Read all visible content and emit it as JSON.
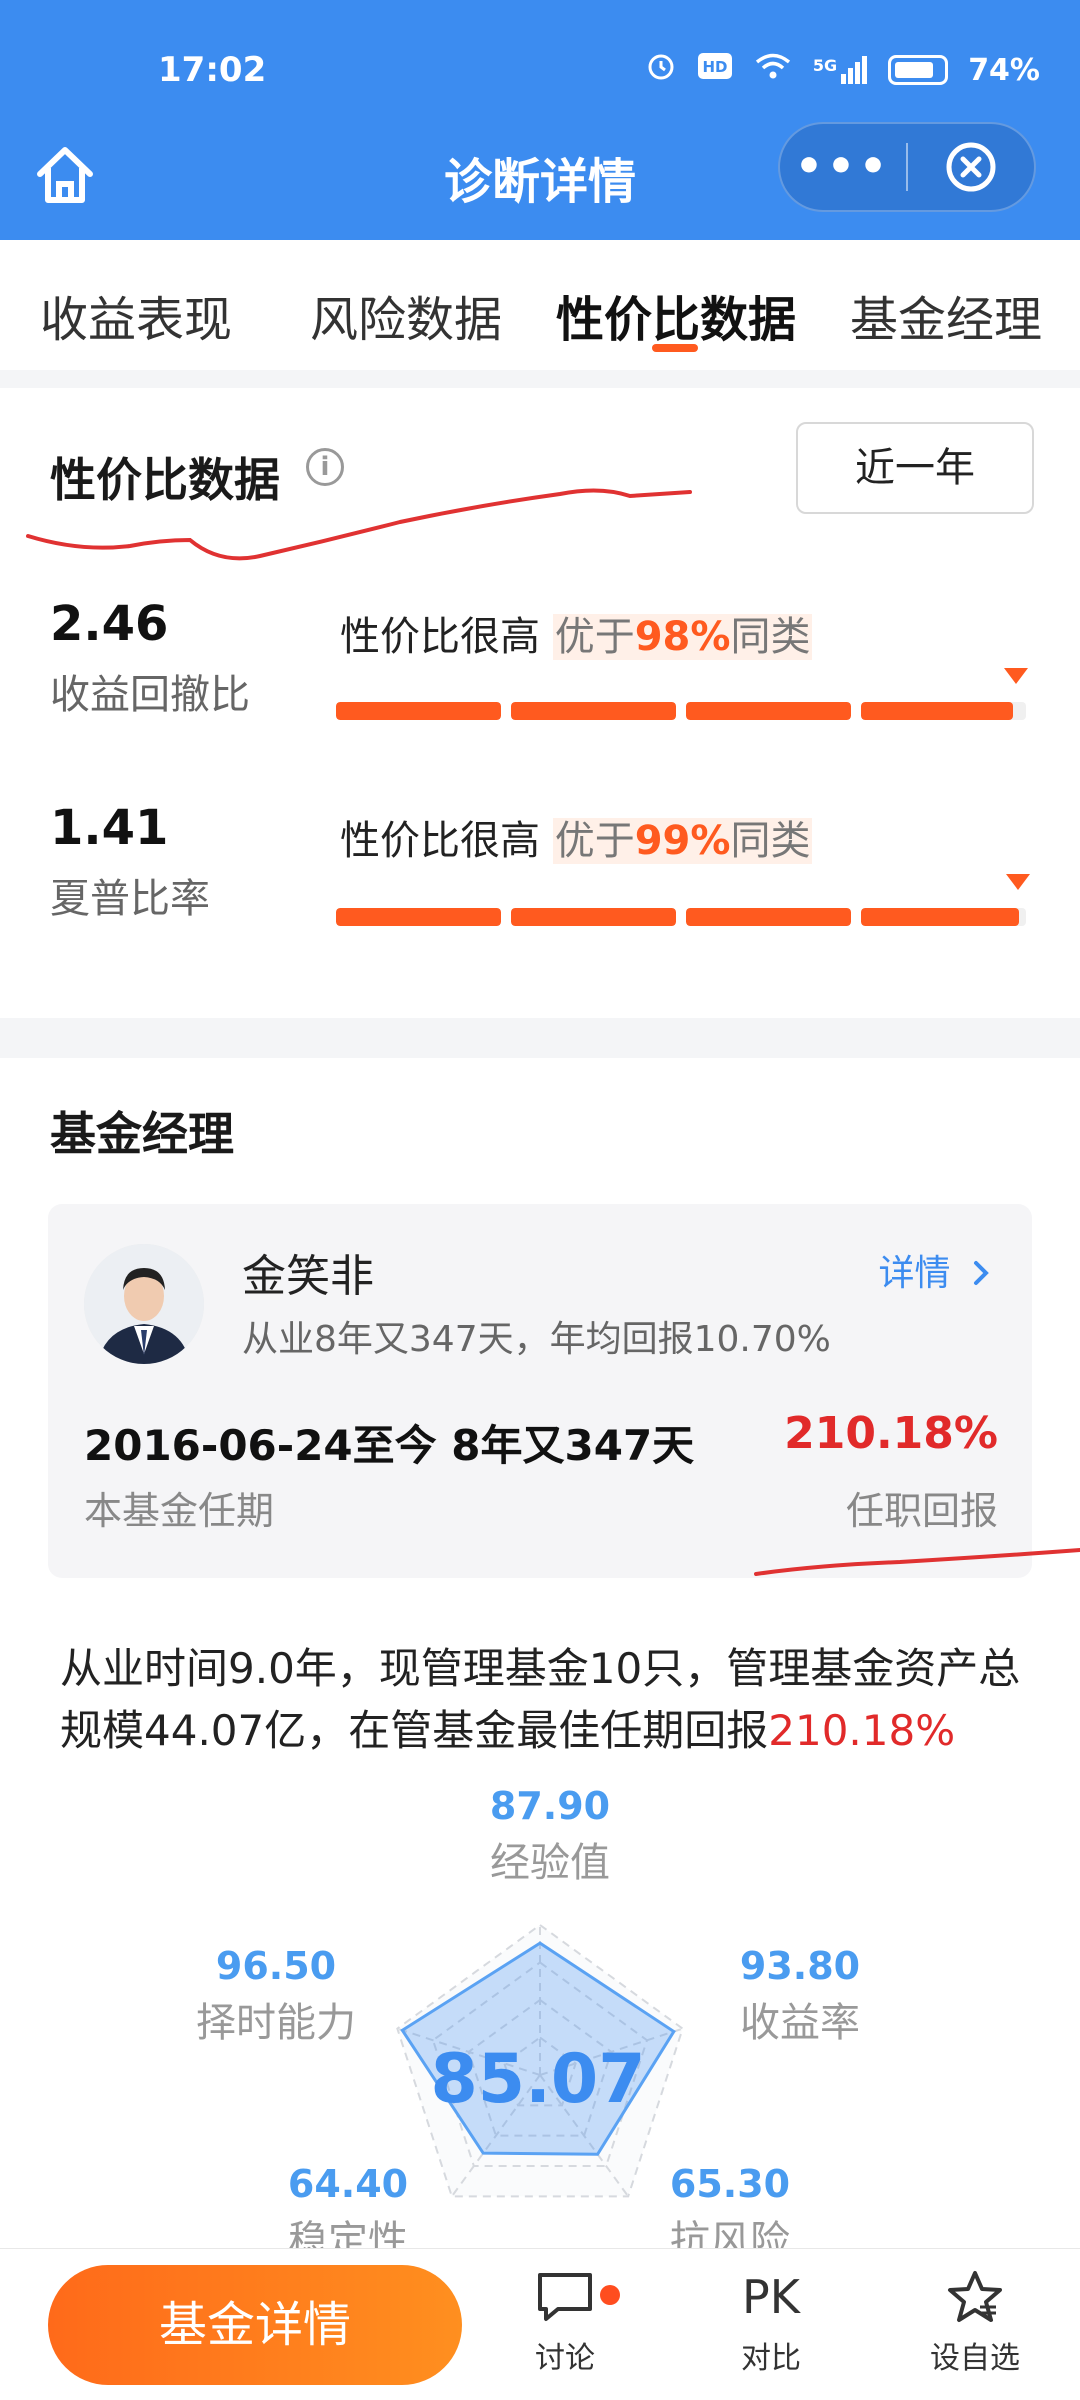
{
  "status_bar": {
    "time": "17:02",
    "network": "5G",
    "battery": "74%"
  },
  "nav": {
    "title": "诊断详情",
    "more": "•••"
  },
  "tabs": [
    "收益表现",
    "风险数据",
    "性价比数据",
    "基金经理"
  ],
  "value_section": {
    "title": "性价比数据",
    "period_button": "近一年",
    "metrics": [
      {
        "value": "2.46",
        "name": "收益回撤比",
        "rating": "性价比很高",
        "better_prefix": "优于",
        "percent": "98%",
        "better_suffix": "同类",
        "level": 0.98
      },
      {
        "value": "1.41",
        "name": "夏普比率",
        "rating": "性价比很高",
        "better_prefix": "优于",
        "percent": "99%",
        "better_suffix": "同类",
        "level": 0.99
      }
    ]
  },
  "manager_section": {
    "title": "基金经理",
    "name": "金笑非",
    "detail_link": "详情",
    "subtitle": "从业8年又347天，年均回报10.70%",
    "tenure": "2016-06-24至今 8年又347天",
    "tenure_label": "本基金任期",
    "return_value": "210.18%",
    "return_label": "任职回报",
    "summary_text": "从业时间9.0年，现管理基金10只，管理基金资产总规模44.07亿，在管基金最佳任期回报",
    "summary_highlight": "210.18%",
    "radar": {
      "score": "85.07",
      "dimensions": [
        {
          "label": "经验值",
          "value": "87.90",
          "score": 87.9
        },
        {
          "label": "收益率",
          "value": "93.80",
          "score": 93.8
        },
        {
          "label": "抗风险",
          "value": "65.30",
          "score": 65.3
        },
        {
          "label": "稳定性",
          "value": "64.40",
          "score": 64.4
        },
        {
          "label": "择时能力",
          "value": "96.50",
          "score": 96.5
        }
      ]
    }
  },
  "bottom_bar": {
    "primary_button": "基金详情",
    "items": [
      {
        "label": "讨论",
        "icon": "chat-icon"
      },
      {
        "label": "对比",
        "icon": "pk-icon",
        "glyph": "PK"
      },
      {
        "label": "设自选",
        "icon": "star-icon"
      }
    ]
  },
  "colors": {
    "brand_blue": "#3c8cf0",
    "accent_orange": "#ff5a1f",
    "return_red": "#e12a2a"
  }
}
